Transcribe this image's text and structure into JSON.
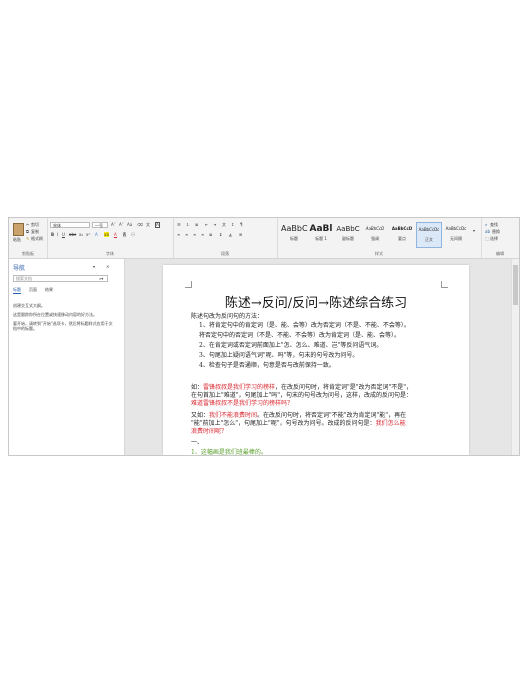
{
  "ribbon": {
    "clipboard": {
      "paste": "粘贴",
      "cut": "剪切",
      "copy": "复制",
      "format_painter": "格式刷",
      "label": "剪贴板"
    },
    "font": {
      "name": "宋体",
      "size": "一号",
      "label": "字体"
    },
    "paragraph": {
      "label": "段落"
    },
    "styles": {
      "label": "样式",
      "items": [
        {
          "sample": "AaBbC",
          "name": "标题"
        },
        {
          "sample": "AaBl",
          "name": "标题 1"
        },
        {
          "sample": "AaBbC",
          "name": "副标题"
        },
        {
          "sample": "AaBbCcD",
          "name": "强调"
        },
        {
          "sample": "AaBbCcD",
          "name": "要点"
        },
        {
          "sample": "AaBbCcDc",
          "name": "正文"
        },
        {
          "sample": "AaBbCcDc",
          "name": "无间隔"
        }
      ]
    },
    "editing": {
      "find": "查找",
      "replace": "替换",
      "select": "选择",
      "label": "编辑"
    }
  },
  "nav": {
    "title": "导航",
    "search_placeholder": "搜索文档",
    "tabs": [
      "标题",
      "页面",
      "结果"
    ],
    "hint1": "创建交互式大纲。",
    "hint2": "这是跟踪你所在位置或快速移动内容的好方法。",
    "hint3": "要开始，请转到\"开始\"选项卡，然后将标题样式应用于文档中的标题。"
  },
  "doc": {
    "title": "陈述→反问/反问→陈述综合练习",
    "intro": "陈述句改为反问句的方法：",
    "steps": [
      "1、将肯定句中的肯定词（是、能、会等）改为否定词（不是、不能、不会等）。",
      "将否定句中的否定词（不是、不能、不会等）改为肯定词（是、能、会等）。",
      "2、在肯定词或否定词前面加上\"怎、怎么、难道、岂\"等反问语气词。",
      "3、句尾加上疑问语气词\"呢、吗\"等，句末的句号改为问号。",
      "4、检查句子是否通顺，句意是否与改前保持一致。"
    ],
    "ex1": {
      "prefix": "如：",
      "s1": "雷锋叔叔是我们学习的榜样",
      "s2": "，在改反问句时，将肯定词\"是\"改为否定词\"不是\"，",
      "s3": "在句首加上\"难道\"，句尾加上\"吗\"，句末的句号改为问号，这样，改成的反问句是：",
      "s4": "难道雷锋叔叔不是我们学习的榜样吗？"
    },
    "ex2": {
      "prefix": "又如：",
      "s1": "我们不能浪费时间",
      "s2": "。在改反问句时，将否定词\"不能\"改为肯定词\"能\"，再在",
      "s3": "\"能\"前加上\"怎么\"，句尾加上\"呢\"，句号改为问号。改成的反问句是：",
      "s4": "我们怎么能",
      "s5": "浪费时间呢？"
    },
    "section": "一、",
    "item1": "1、这幅画是我们班最棒的。"
  }
}
